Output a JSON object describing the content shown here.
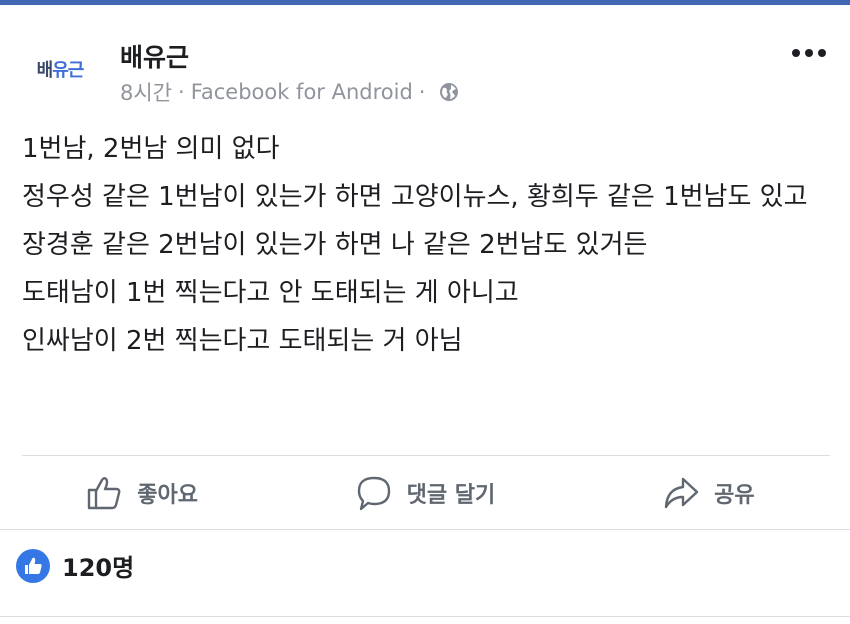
{
  "post": {
    "avatar_text_1": "배",
    "avatar_text_2": "유근",
    "author": "배유근",
    "time": "8시간",
    "source": "Facebook for Android",
    "separator": "·",
    "lines": [
      "1번남, 2번남 의미 없다",
      "정우성 같은 1번남이 있는가 하면 고양이뉴스, 황희두 같은 1번남도 있고",
      "장경훈 같은 2번남이 있는가 하면 나 같은 2번남도 있거든",
      "도태남이 1번 찍는다고 안 도태되는 게 아니고",
      "인싸남이 2번 찍는다고 도태되는 거 아님"
    ]
  },
  "actions": {
    "like": "좋아요",
    "comment": "댓글 달기",
    "share": "공유"
  },
  "reactions": {
    "count": "120명"
  },
  "colors": {
    "brand": "#4267b2",
    "like_blue": "#3578e5",
    "text": "#1c1e21",
    "muted": "#90949c",
    "action_gray": "#606770"
  }
}
